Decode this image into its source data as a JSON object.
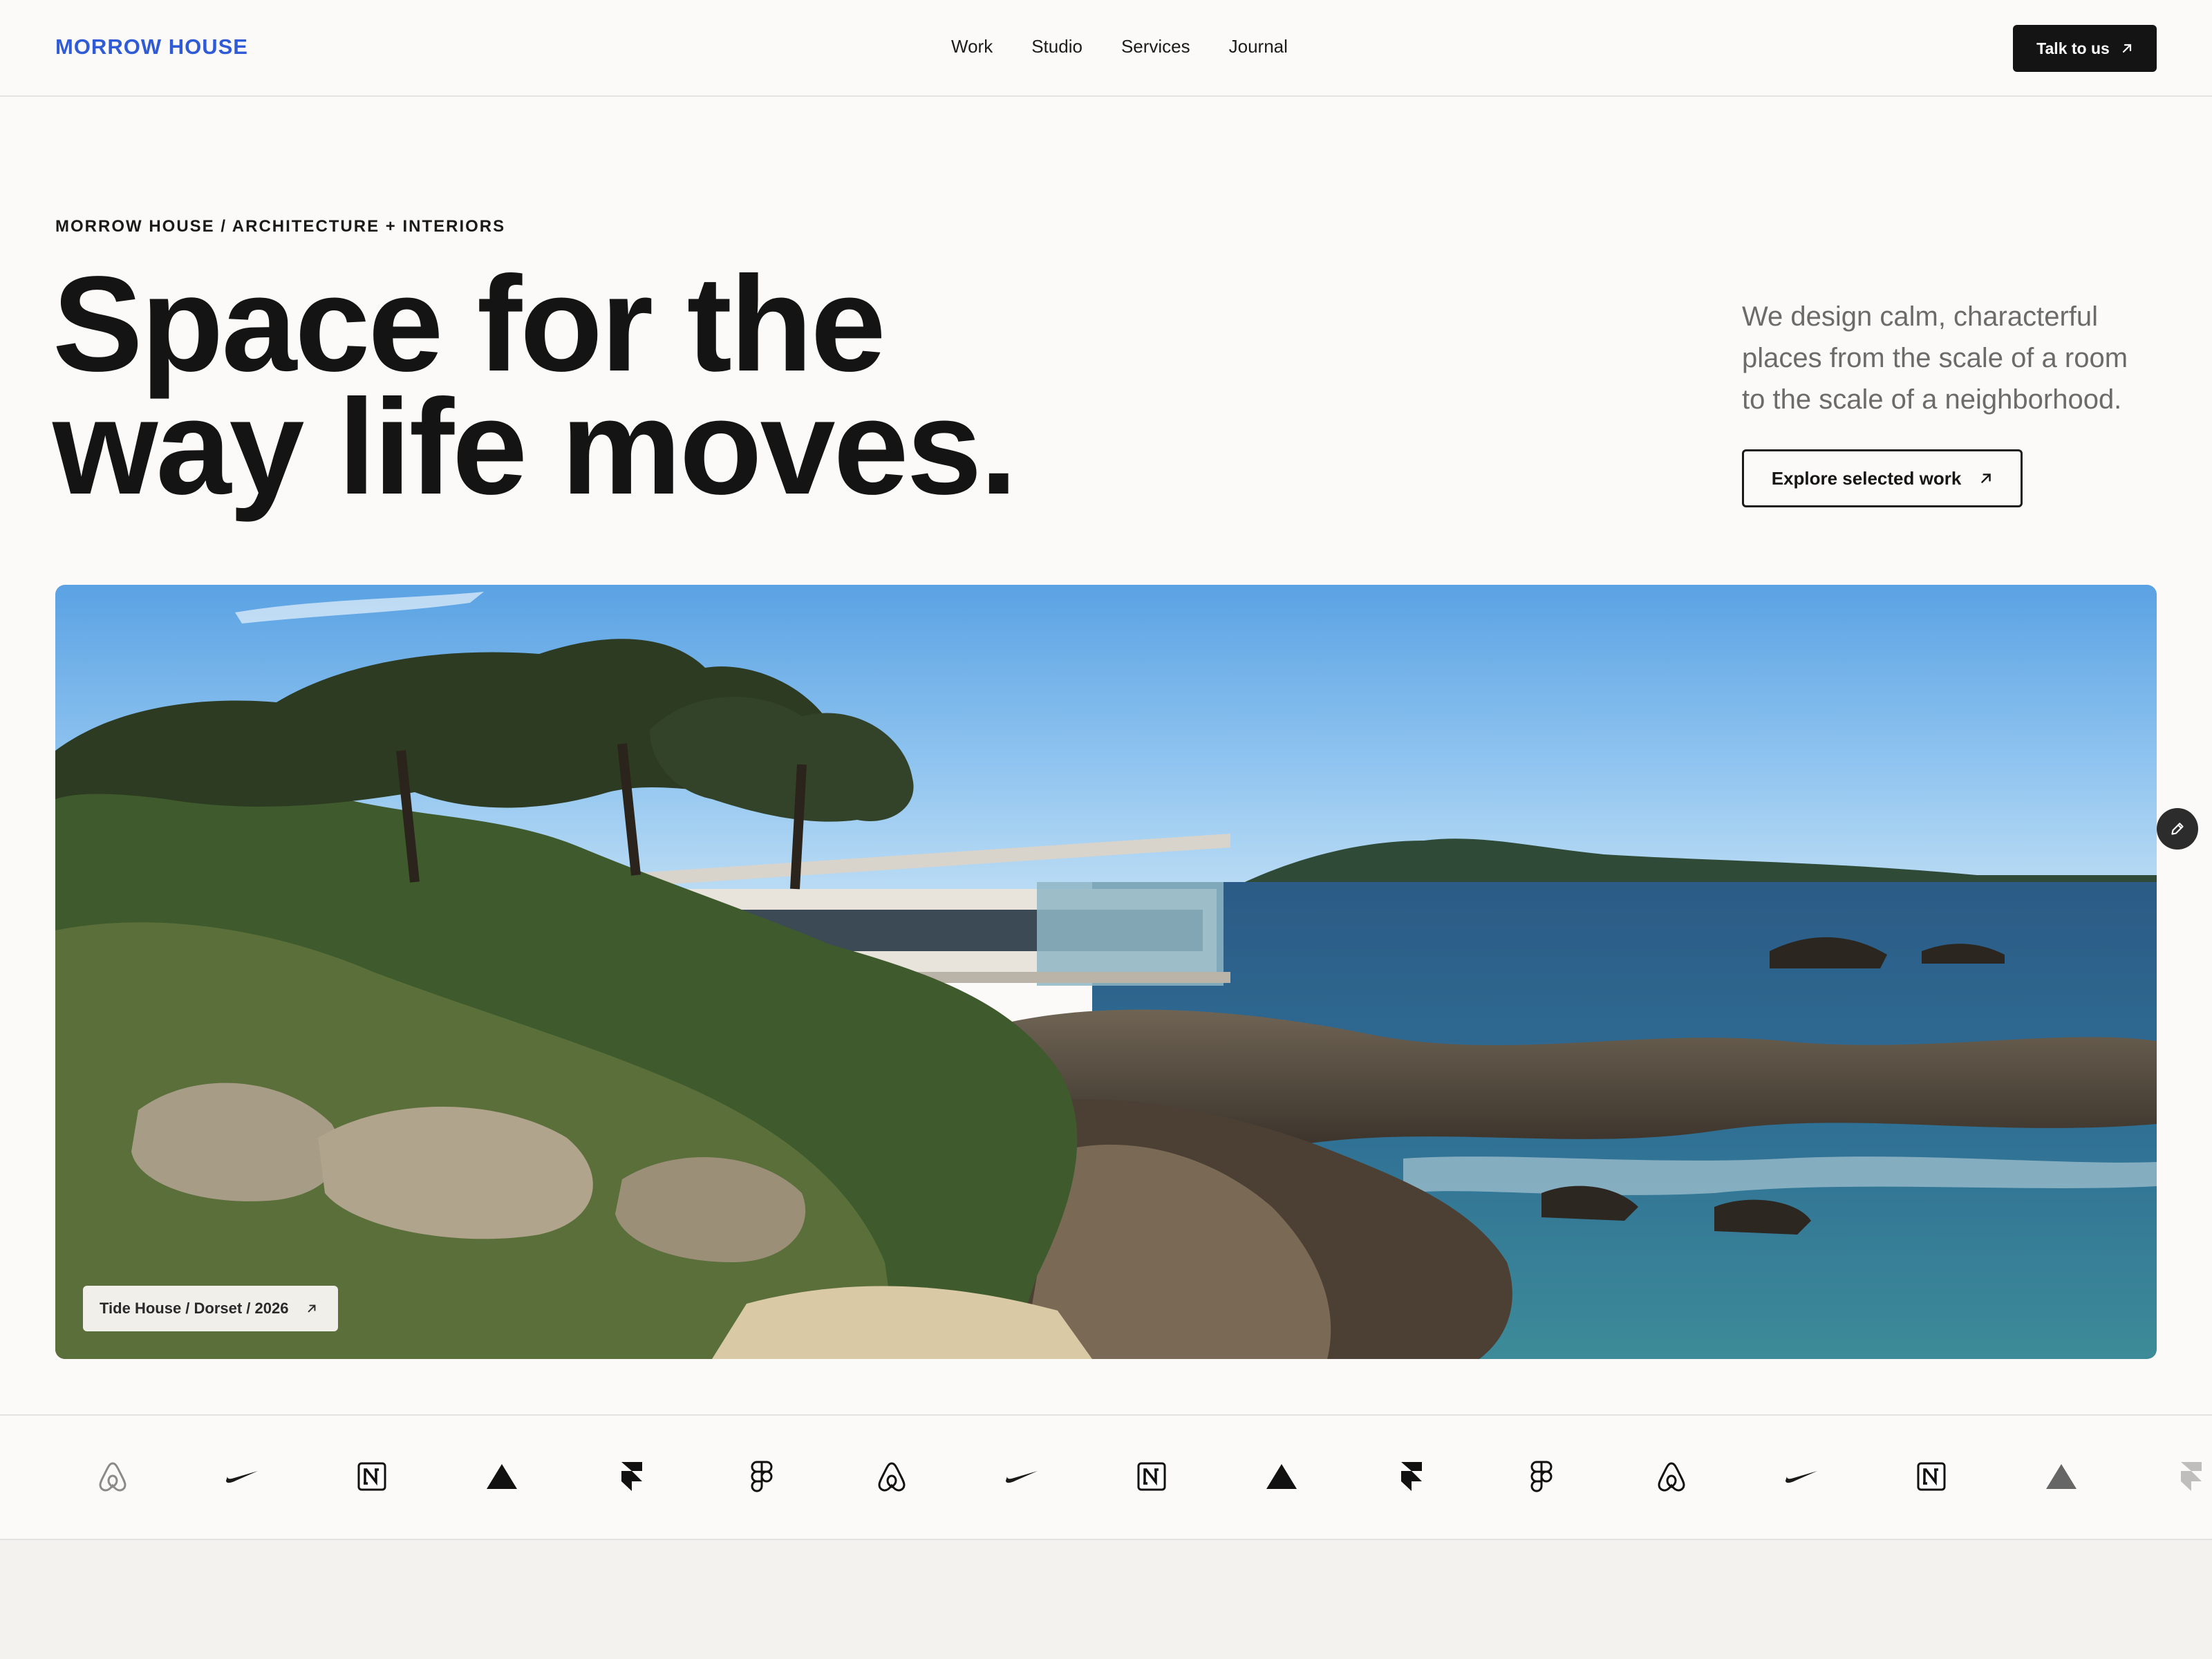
{
  "header": {
    "brand": "MORROW HOUSE",
    "nav": [
      "Work",
      "Studio",
      "Services",
      "Journal"
    ],
    "cta_label": "Talk to us"
  },
  "hero": {
    "eyebrow": "MORROW HOUSE / ARCHITECTURE + INTERIORS",
    "headline_line1": "Space for the",
    "headline_line2": "way life moves.",
    "blurb": "We design calm, characterful places from the scale of a room to the scale of a neighborhood.",
    "explore_label": "Explore selected work",
    "image_caption": "Tide House / Dorset / 2026"
  },
  "logos": [
    "airbnb-icon",
    "nike-icon",
    "notion-icon",
    "vercel-icon",
    "framer-icon",
    "figma-icon",
    "airbnb-icon",
    "nike-icon",
    "notion-icon",
    "vercel-icon",
    "framer-icon",
    "figma-icon",
    "airbnb-icon",
    "nike-icon",
    "notion-icon",
    "vercel-icon",
    "framer-icon"
  ],
  "colors": {
    "brand": "#2f5bd6",
    "ink": "#141414",
    "background": "#fbfaf8"
  }
}
